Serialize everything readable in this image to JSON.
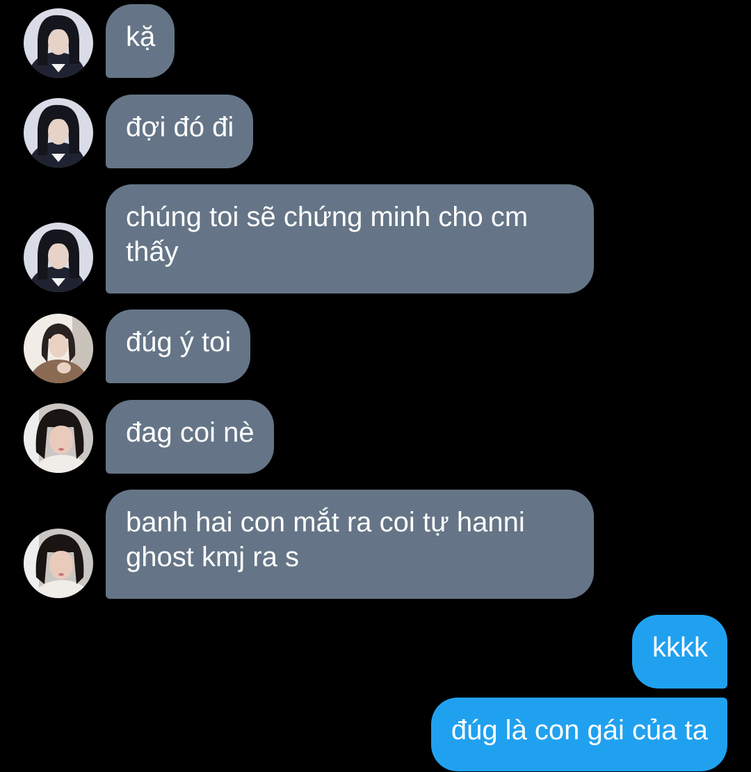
{
  "colors": {
    "background": "#000000",
    "incoming_bubble": "#657587",
    "outgoing_bubble": "#20a1f0",
    "text": "#ffffff"
  },
  "messages": [
    {
      "side": "in",
      "avatar": "avatar-girl-dark-uniform",
      "text": "kặ"
    },
    {
      "side": "in",
      "avatar": "avatar-girl-dark-uniform",
      "text": "đợi đó đi"
    },
    {
      "side": "in",
      "avatar": "avatar-girl-dark-uniform",
      "text": "chúng toi sẽ chứng minh cho cm thấy"
    },
    {
      "side": "in",
      "avatar": "avatar-girl-brown-coat",
      "text": "đúg ý toi"
    },
    {
      "side": "in",
      "avatar": "avatar-girl-selfie",
      "text": "đag coi nè"
    },
    {
      "side": "in",
      "avatar": "avatar-girl-selfie",
      "text": "banh hai con mắt ra coi tự hanni ghost kmj ra s"
    },
    {
      "side": "out",
      "text": "kkkk"
    },
    {
      "side": "out",
      "text": "đúg là con gái của ta"
    }
  ]
}
